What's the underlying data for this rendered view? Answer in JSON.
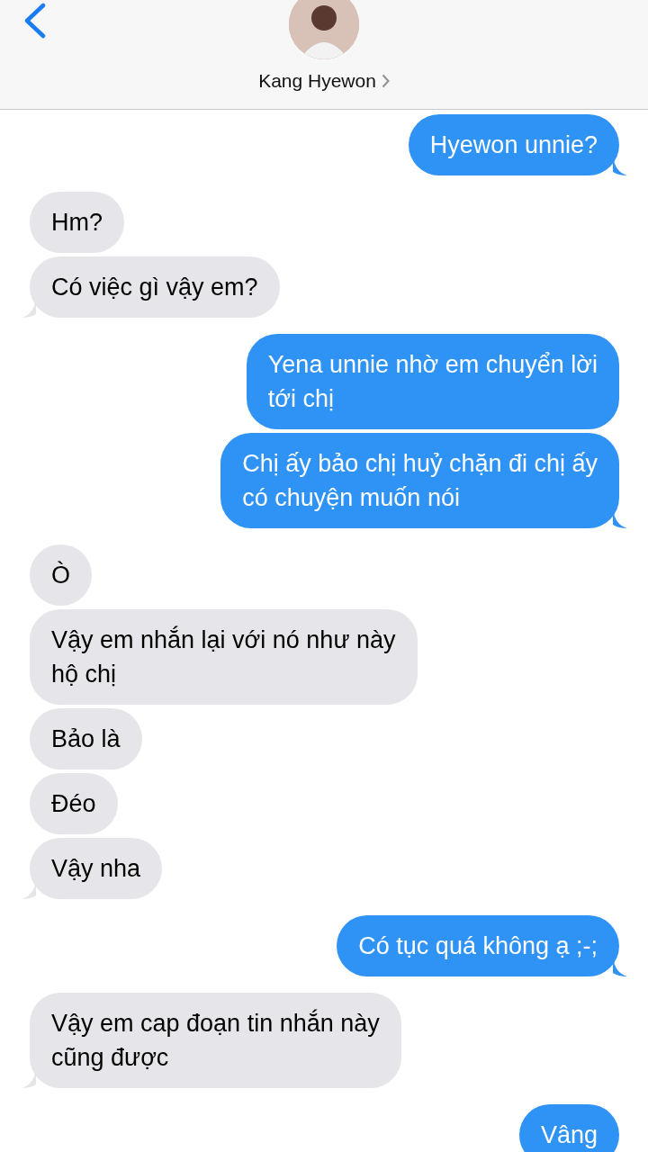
{
  "header": {
    "contact_name": "Kang Hyewon"
  },
  "messages": [
    {
      "kind": "sent",
      "lines": [
        "Hyewon unnie?"
      ]
    },
    {
      "kind": "received",
      "lines": [
        "Hm?"
      ]
    },
    {
      "kind": "received",
      "lines": [
        "Có việc gì vậy em?"
      ]
    },
    {
      "kind": "sent",
      "lines": [
        "Yena unnie nhờ em chuyển lời",
        "tới chị"
      ]
    },
    {
      "kind": "sent",
      "lines": [
        "Chị ấy bảo chị huỷ chặn đi chị ấy",
        "có chuyện muốn nói"
      ]
    },
    {
      "kind": "received",
      "lines": [
        "Ò"
      ]
    },
    {
      "kind": "received",
      "lines": [
        "Vậy em nhắn lại với nó như này",
        "hộ chị"
      ]
    },
    {
      "kind": "received",
      "lines": [
        "Bảo là"
      ]
    },
    {
      "kind": "received",
      "lines": [
        "Đéo"
      ]
    },
    {
      "kind": "received",
      "lines": [
        "Vậy nha"
      ]
    },
    {
      "kind": "sent",
      "lines": [
        "Có tục quá không ạ ;-;"
      ]
    },
    {
      "kind": "received",
      "lines": [
        "Vậy em cap đoạn tin nhắn này",
        "cũng được"
      ]
    },
    {
      "kind": "sent",
      "lines": [
        "Vâng"
      ]
    }
  ]
}
